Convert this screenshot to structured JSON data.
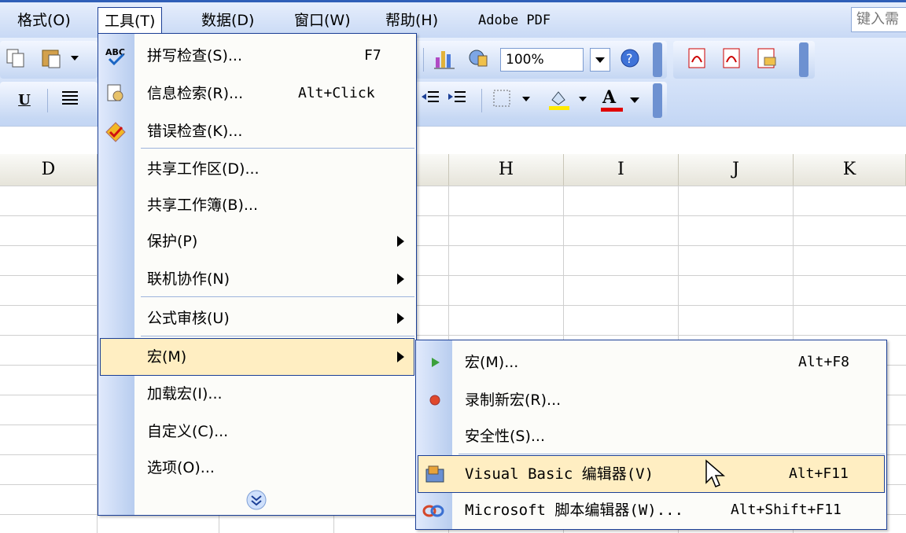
{
  "menubar": {
    "items": [
      "格式(O)",
      "工具(T)",
      "数据(D)",
      "窗口(W)",
      "帮助(H)",
      "Adobe PDF"
    ],
    "ask_placeholder": "键入需"
  },
  "toolbar": {
    "zoom": "100%",
    "icons": [
      "copy-icon",
      "paste-icon",
      "chart-icon",
      "drawing-icon",
      "help-icon",
      "pdf-icon",
      "pdf-review-icon",
      "pdf-email-icon",
      "underline-icon",
      "align-icon",
      "decrease-indent-icon",
      "increase-indent-icon",
      "borders-icon",
      "fill-color-icon",
      "font-color-icon"
    ],
    "underline_label": "U",
    "font_color_label": "A"
  },
  "columns": [
    "D",
    "H",
    "I",
    "J",
    "K"
  ],
  "tools_menu": {
    "items": [
      {
        "label": "拼写检查(S)...",
        "shortcut": "F7",
        "icon": "spelling-icon"
      },
      {
        "label": "信息检索(R)...",
        "shortcut": "Alt+Click",
        "icon": "research-icon"
      },
      {
        "label": "错误检查(K)...",
        "shortcut": "",
        "icon": "error-check-icon"
      },
      {
        "label": "共享工作区(D)...",
        "shortcut": ""
      },
      {
        "label": "共享工作簿(B)...",
        "shortcut": ""
      },
      {
        "label": "保护(P)",
        "shortcut": "",
        "submenu": true
      },
      {
        "label": "联机协作(N)",
        "shortcut": "",
        "submenu": true
      },
      {
        "label": "公式审核(U)",
        "shortcut": "",
        "submenu": true
      },
      {
        "label": "宏(M)",
        "shortcut": "",
        "submenu": true,
        "highlighted": true
      },
      {
        "label": "加载宏(I)...",
        "shortcut": ""
      },
      {
        "label": "自定义(C)...",
        "shortcut": ""
      },
      {
        "label": "选项(O)...",
        "shortcut": ""
      }
    ],
    "expand_icon": "expand-chevrons-icon"
  },
  "macro_menu": {
    "items": [
      {
        "label": "宏(M)...",
        "shortcut": "Alt+F8",
        "icon": "run-macro-icon"
      },
      {
        "label": "录制新宏(R)...",
        "shortcut": "",
        "icon": "record-icon"
      },
      {
        "label": "安全性(S)...",
        "shortcut": ""
      },
      {
        "label": "Visual Basic 编辑器(V)",
        "shortcut": "Alt+F11",
        "icon": "vb-editor-icon",
        "highlighted": true
      },
      {
        "label": "Microsoft 脚本编辑器(W)...",
        "shortcut": "Alt+Shift+F11",
        "icon": "script-editor-icon"
      }
    ]
  },
  "colors": {
    "accent": "#1b3f96",
    "highlight": "#ffeec2",
    "menubar": "#c8d9f5"
  }
}
